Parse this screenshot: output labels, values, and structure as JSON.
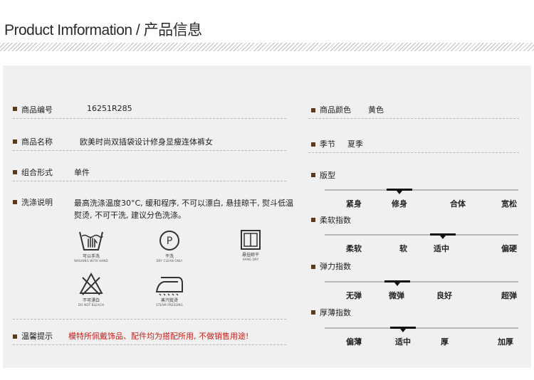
{
  "header": {
    "title": "Product Imformation / 产品信息"
  },
  "left": {
    "product_code": {
      "label": "商品编号",
      "value": "16251R285"
    },
    "product_name": {
      "label": "商品名称",
      "value": "欧美时尚双插袋设计修身显瘦连体裤女"
    },
    "composition": {
      "label": "组合形式",
      "value": "单件"
    },
    "washing": {
      "label": "洗涤说明",
      "text": "最高洗涤温度30°C, 缓和程序, 不可以漂白, 悬挂晾干, 熨斗低温熨烫, 不可干洗, 建议分色洗涤。"
    },
    "care_icons": [
      {
        "icon": "hand-wash-icon",
        "cn": "可以手洗",
        "en": "WASHING WITH HAND"
      },
      {
        "icon": "dry-clean-icon",
        "cn": "干洗",
        "en": "DRY CLEAN ONLY",
        "symbol": "P"
      },
      {
        "icon": "hang-dry-icon",
        "cn": "悬挂晾干",
        "en": "HANG DRY"
      },
      {
        "icon": "do-not-bleach-icon",
        "cn": "不可漂白",
        "en": "DO NOT BLEACH"
      },
      {
        "icon": "steam-iron-icon",
        "cn": "蒸汽熨烫",
        "en": "STEAM PRESSING"
      }
    ],
    "tips": {
      "label": "温馨提示",
      "value": "模特所佩戴饰品、配件均为搭配所用, 不做销售用途!"
    }
  },
  "right": {
    "color": {
      "label": "商品颜色",
      "value": "黄色"
    },
    "season": {
      "label": "季节",
      "value": "夏季"
    },
    "scales": [
      {
        "label": "版型",
        "options": [
          "紧身",
          "修身",
          "合体",
          "宽松"
        ],
        "selected": 1
      },
      {
        "label": "柔软指数",
        "options": [
          "柔软",
          "软",
          "适中",
          "偏硬"
        ],
        "selected": 2
      },
      {
        "label": "弹力指数",
        "options": [
          "无弹",
          "微弹",
          "良好",
          "超弹"
        ],
        "selected": 1
      },
      {
        "label": "厚薄指数",
        "options": [
          "偏薄",
          "适中",
          "厚",
          "加厚"
        ],
        "selected": 1
      }
    ]
  },
  "colors": {
    "bullet": "#5a3a1a",
    "warning": "#c8201c",
    "panel": "#f0f0f0"
  }
}
